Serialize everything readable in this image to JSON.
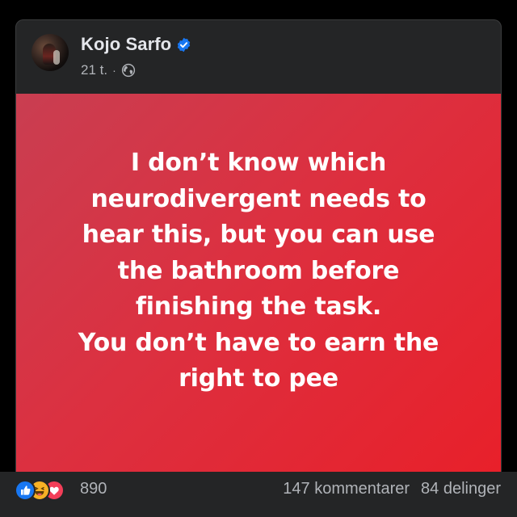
{
  "post": {
    "author_name": "Kojo Sarfo",
    "time_ago": "21 t.",
    "separator": "·",
    "verified_icon": "verified-badge-icon",
    "audience_icon": "globe-icon",
    "text": "I don’t know which\nneurodivergent needs to\nhear this, but you can use\nthe bathroom before\nfinishing the task.\nYou don’t have to earn the\nright to pee",
    "background_colors": [
      "#c93e51",
      "#e8202a"
    ]
  },
  "engagement": {
    "reaction_icons": [
      "like-icon",
      "haha-icon",
      "love-icon"
    ],
    "reaction_count": "890",
    "comments": "147 kommentarer",
    "shares": "84 delinger"
  },
  "colors": {
    "card_bg": "#242526",
    "primary_text": "#e4e6eb",
    "secondary_text": "#b0b3b8",
    "verified_blue": "#1877f2"
  }
}
